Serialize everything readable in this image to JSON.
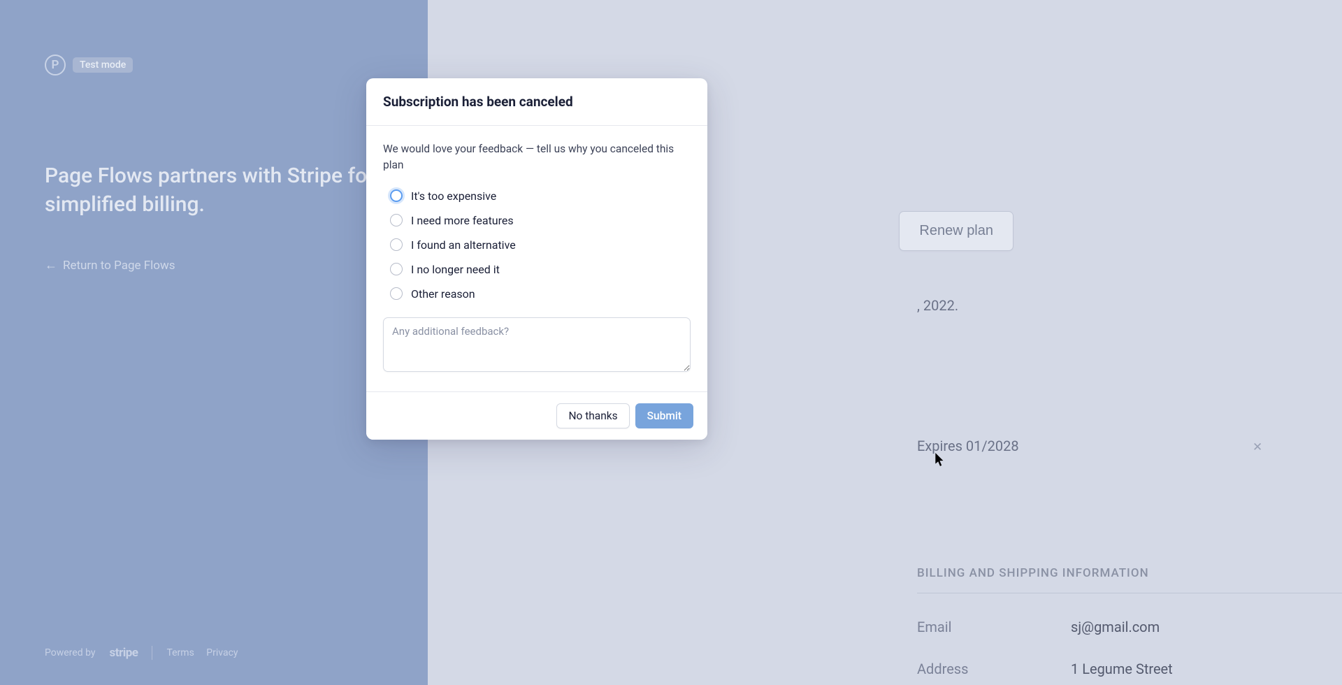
{
  "brand": {
    "logo_letter": "P",
    "test_mode_label": "Test mode"
  },
  "headline": "Page Flows partners with Stripe for simplified billing.",
  "return_link": "Return to Page Flows",
  "footer": {
    "powered_by": "Powered by",
    "stripe": "stripe",
    "terms": "Terms",
    "privacy": "Privacy"
  },
  "right": {
    "renew_button": "Renew plan",
    "canceled_suffix": ", 2022.",
    "payment_expires": "Expires 01/2028",
    "billing_header": "BILLING AND SHIPPING INFORMATION",
    "email_label": "Email",
    "email_value": "sj@gmail.com",
    "address_label": "Address",
    "address_value": "1 Legume Street"
  },
  "modal": {
    "title": "Subscription has been canceled",
    "description": "We would love your feedback — tell us why you canceled this plan",
    "options": [
      "It's too expensive",
      "I need more features",
      "I found an alternative",
      "I no longer need it",
      "Other reason"
    ],
    "textarea_placeholder": "Any additional feedback?",
    "no_thanks": "No thanks",
    "submit": "Submit"
  }
}
